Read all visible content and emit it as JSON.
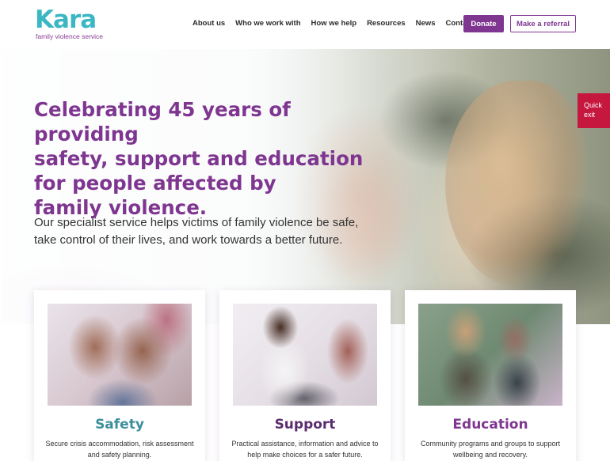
{
  "logo": {
    "name": "Kara",
    "tagline": "family violence service"
  },
  "nav": {
    "items": [
      "About us",
      "Who we work with",
      "How we help",
      "Resources",
      "News",
      "Contact"
    ],
    "donate_label": "Donate",
    "referral_label": "Make a referral"
  },
  "hero": {
    "title_lines": [
      "Celebrating 45 years of providing",
      "safety, support and education",
      "for people affected by",
      "family violence."
    ],
    "subtitle_lines": [
      "Our specialist service helps victims of family violence be safe,",
      "take control of their lives, and work towards a better future."
    ]
  },
  "quick_exit": {
    "line1": "Quick",
    "line2": "exit"
  },
  "cards": [
    {
      "title": "Safety",
      "desc_lines": [
        "Secure crisis accommodation, risk assessment",
        "and safety planning."
      ],
      "color": "#3d8f9b"
    },
    {
      "title": "Support",
      "desc_lines": [
        "Practical assistance, information and advice to",
        "help make choices for a safer future."
      ],
      "color": "#5b2c6f"
    },
    {
      "title": "Education",
      "desc_lines": [
        "Community programs and groups to support",
        "wellbeing and recovery."
      ],
      "color": "#7e3690"
    }
  ],
  "colors": {
    "brand_teal": "#3bb7c4",
    "brand_purple": "#7e3690",
    "quick_exit_red": "#c6173f"
  }
}
